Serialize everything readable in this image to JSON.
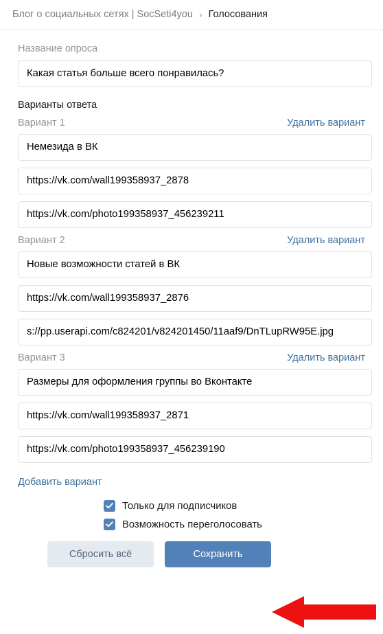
{
  "breadcrumb": {
    "root": "Блог о социальных сетях | SocSeti4you",
    "separator": "›",
    "current": "Голосования"
  },
  "form": {
    "poll_title_label": "Название опроса",
    "poll_title_value": "Какая статья больше всего понравилась?",
    "answers_label": "Варианты ответа",
    "delete_variant_label": "Удалить вариант",
    "add_variant_label": "Добавить вариант",
    "variants": [
      {
        "label": "Вариант 1",
        "text": "Немезида в ВК",
        "link": "https://vk.com/wall199358937_2878",
        "image": "https://vk.com/photo199358937_456239211"
      },
      {
        "label": "Вариант 2",
        "text": "Новые возможности статей в ВК",
        "link": "https://vk.com/wall199358937_2876",
        "image": "s://pp.userapi.com/c824201/v824201450/11aaf9/DnTLupRW95E.jpg"
      },
      {
        "label": "Вариант 3",
        "text": "Размеры для оформления группы во Вконтакте",
        "link": "https://vk.com/wall199358937_2871",
        "image": "https://vk.com/photo199358937_456239190"
      }
    ],
    "checkboxes": [
      {
        "label": "Только для подписчиков",
        "checked": true
      },
      {
        "label": "Возможность переголосовать",
        "checked": true
      }
    ],
    "reset_button": "Сбросить всё",
    "save_button": "Сохранить"
  },
  "annotation": {
    "arrow_color": "#ee1111",
    "arrow_direction": "left",
    "points_at": "Сохранить"
  },
  "colors": {
    "accent_blue": "#5181b8",
    "link_blue": "#3f6f9f",
    "reset_gray": "#e4eaf0",
    "border_gray": "#dfe1e5",
    "muted_text": "#939599"
  }
}
